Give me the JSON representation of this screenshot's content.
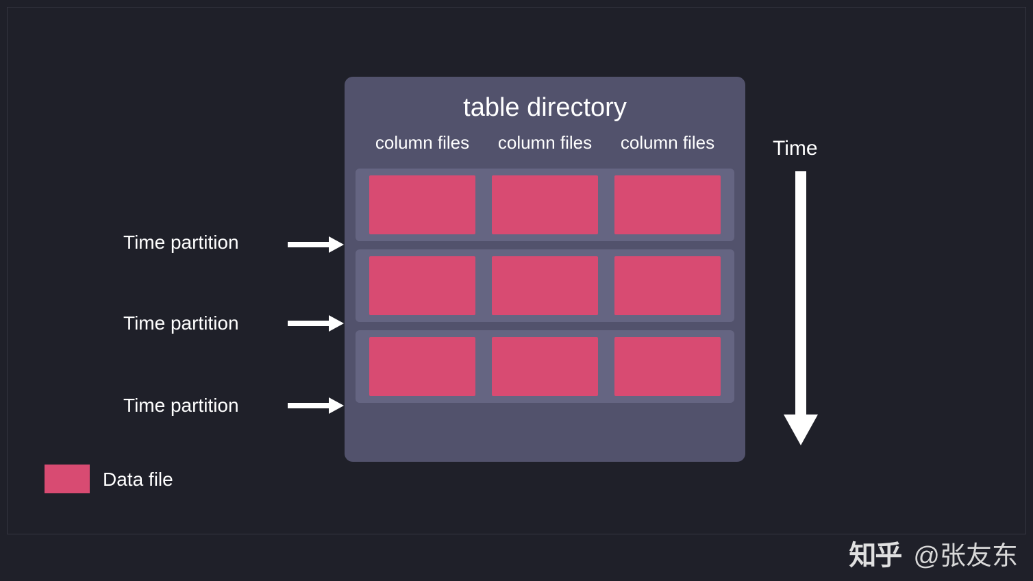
{
  "diagram": {
    "title": "table directory",
    "column_headers": [
      "column files",
      "column files",
      "column files"
    ],
    "row_labels": [
      "Time partition",
      "Time partition",
      "Time partition"
    ],
    "time_axis_label": "Time",
    "legend": {
      "data_file": "Data file"
    }
  },
  "watermark": {
    "platform": "知乎",
    "author": "@张友东"
  },
  "colors": {
    "background": "#1f2029",
    "directory_box": "#52526c",
    "partition_row": "#656582",
    "data_file": "#d84b72",
    "text": "#ffffff"
  }
}
